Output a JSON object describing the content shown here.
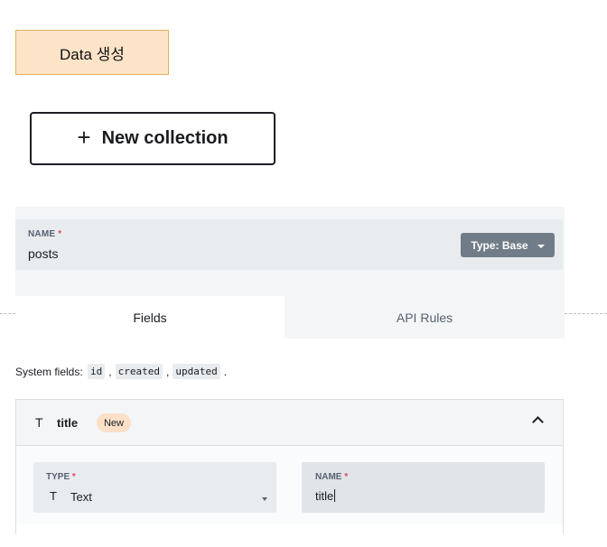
{
  "top_label": "Data 생성",
  "new_collection": {
    "icon": "plus-icon",
    "plus_glyph": "+",
    "label": "New collection"
  },
  "collection": {
    "name_caption": "NAME",
    "required_mark": "*",
    "name_value": "posts",
    "type_button": "Type: Base"
  },
  "tabs": [
    {
      "label": "Fields",
      "active": true
    },
    {
      "label": "API Rules",
      "active": false
    }
  ],
  "system_fields": {
    "prefix": "System fields:",
    "items": [
      "id",
      "created",
      "updated"
    ],
    "sep": ",",
    "end": "."
  },
  "field": {
    "icon_glyph": "T",
    "title": "title",
    "badge": "New",
    "type_caption": "TYPE",
    "type_icon_glyph": "T",
    "type_value": "Text",
    "name_caption": "NAME",
    "name_value": "title"
  },
  "colors": {
    "accent_label_bg": "#fde4c8",
    "type_button_bg": "#707c87",
    "required": "#e34562",
    "badge_bg": "#fbe0c7"
  }
}
